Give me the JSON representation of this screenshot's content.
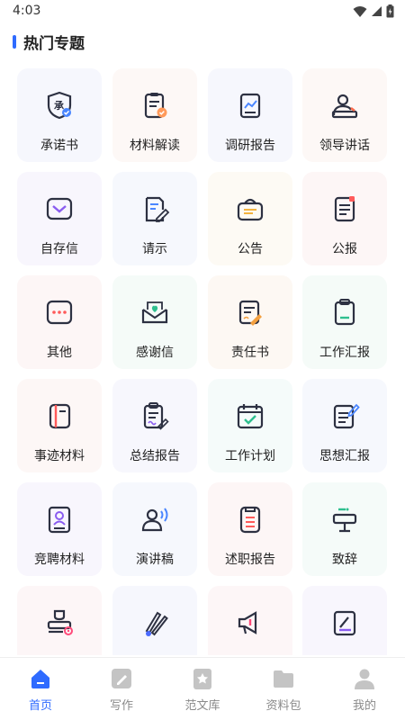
{
  "status_bar": {
    "time": "4:03"
  },
  "section": {
    "title": "热门专题"
  },
  "topics": [
    {
      "label": "承诺书",
      "icon": "commitment-shield-icon",
      "bg": "#f6f7fd"
    },
    {
      "label": "材料解读",
      "icon": "clipboard-check-icon",
      "bg": "#fdf8f6"
    },
    {
      "label": "调研报告",
      "icon": "chart-report-icon",
      "bg": "#f6f7fd"
    },
    {
      "label": "领导讲话",
      "icon": "podium-speaker-icon",
      "bg": "#fdf8f6"
    },
    {
      "label": "自存信",
      "icon": "envelope-icon",
      "bg": "#f8f6fd"
    },
    {
      "label": "请示",
      "icon": "edit-document-icon",
      "bg": "#f6f8fd"
    },
    {
      "label": "公告",
      "icon": "notice-box-icon",
      "bg": "#fdfaf4"
    },
    {
      "label": "公报",
      "icon": "bulletin-icon",
      "bg": "#fdf6f6"
    },
    {
      "label": "其他",
      "icon": "more-dots-icon",
      "bg": "#fdf6f6"
    },
    {
      "label": "感谢信",
      "icon": "heart-letter-icon",
      "bg": "#f5fbf8"
    },
    {
      "label": "责任书",
      "icon": "signed-document-icon",
      "bg": "#fdf8f3"
    },
    {
      "label": "工作汇报",
      "icon": "clipboard-icon",
      "bg": "#f5fbf8"
    },
    {
      "label": "事迹材料",
      "icon": "notebook-icon",
      "bg": "#fdf7f6"
    },
    {
      "label": "总结报告",
      "icon": "summary-clipboard-icon",
      "bg": "#f7f7fd"
    },
    {
      "label": "工作计划",
      "icon": "calendar-check-icon",
      "bg": "#f5fbfa"
    },
    {
      "label": "思想汇报",
      "icon": "thought-report-icon",
      "bg": "#f6f8fd"
    },
    {
      "label": "竞聘材料",
      "icon": "profile-card-icon",
      "bg": "#f8f6fd"
    },
    {
      "label": "演讲稿",
      "icon": "speech-person-icon",
      "bg": "#f6f8fd"
    },
    {
      "label": "述职报告",
      "icon": "report-document-icon",
      "bg": "#fdf6f6"
    },
    {
      "label": "致辞",
      "icon": "lectern-icon",
      "bg": "#f5fbf9"
    },
    {
      "label": "",
      "icon": "stamp-seal-icon",
      "bg": "#fdf6f7"
    },
    {
      "label": "",
      "icon": "pen-tools-icon",
      "bg": "#f6f7fd"
    },
    {
      "label": "",
      "icon": "megaphone-icon",
      "bg": "#fdf6f7"
    },
    {
      "label": "",
      "icon": "edit-note-icon",
      "bg": "#f8f6fd"
    }
  ],
  "tabs": [
    {
      "label": "首页",
      "icon": "home-icon",
      "active": true
    },
    {
      "label": "写作",
      "icon": "pen-icon",
      "active": false
    },
    {
      "label": "范文库",
      "icon": "library-star-icon",
      "active": false
    },
    {
      "label": "资料包",
      "icon": "folder-icon",
      "active": false
    },
    {
      "label": "我的",
      "icon": "user-icon",
      "active": false
    }
  ],
  "colors": {
    "accent": "#2f6bff",
    "icon_dark": "#2d3142",
    "tab_inactive": "#c4c4c4"
  }
}
